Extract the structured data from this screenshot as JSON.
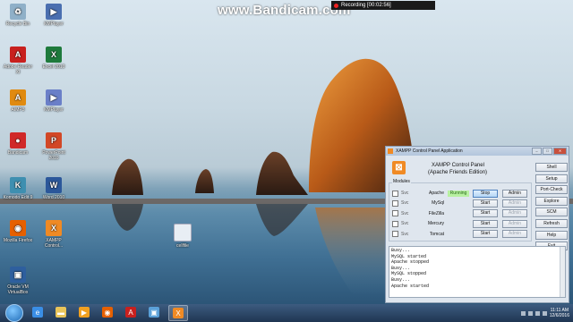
{
  "watermark": "www.Bandicam.com",
  "recording": {
    "label": "Recording [00:02:56]"
  },
  "desktop_icons": [
    {
      "label": "Recycle Bin",
      "icon": "recycle-bin-icon",
      "color": "#8fb0c8",
      "glyph": "♻"
    },
    {
      "label": "KMPlayer",
      "icon": "kmplayer-icon",
      "color": "#4a6fb0",
      "glyph": "▶"
    },
    {
      "label": "Adobe Reader XI",
      "icon": "adobe-reader-icon",
      "color": "#c8201e",
      "glyph": "A"
    },
    {
      "label": "Excel 2010",
      "icon": "excel-icon",
      "color": "#1e7a3c",
      "glyph": "X"
    },
    {
      "label": "AIMP3",
      "icon": "aimp-icon",
      "color": "#e08a10",
      "glyph": "A"
    },
    {
      "label": "KMPlayer",
      "icon": "kmplayer-icon",
      "color": "#6a7fc8",
      "glyph": "▶"
    },
    {
      "label": "Bandicam",
      "icon": "bandicam-icon",
      "color": "#d02828",
      "glyph": "●"
    },
    {
      "label": "PowerPoint 2010",
      "icon": "powerpoint-icon",
      "color": "#d24726",
      "glyph": "P"
    },
    {
      "label": "Komodo Edit 9",
      "icon": "komodo-icon",
      "color": "#3e8fb0",
      "glyph": "K"
    },
    {
      "label": "Word 2010",
      "icon": "word-icon",
      "color": "#2b579a",
      "glyph": "W"
    },
    {
      "label": "Mozilla Firefox",
      "icon": "firefox-icon",
      "color": "#e66000",
      "glyph": "◉"
    },
    {
      "label": "XAMPP Control...",
      "icon": "xampp-icon",
      "color": "#f08a24",
      "glyph": "X"
    },
    {
      "label": "Oracle VM VirtualBox",
      "icon": "virtualbox-icon",
      "color": "#2e5f9e",
      "glyph": "▣"
    },
    {
      "label": "cellfile",
      "icon": "file-icon",
      "color": "#e8eef4",
      "glyph": ""
    }
  ],
  "xampp": {
    "title": "XAMPP Control Panel Application",
    "header_line1": "XAMPP Control Panel",
    "header_line2": "(Apache Friends Edition)",
    "modules_label": "Modules",
    "svc_label": "Svc",
    "modules": [
      {
        "name": "Apache",
        "status": "Running",
        "action": "Stop",
        "admin": "Admin",
        "running": true
      },
      {
        "name": "MySql",
        "status": "",
        "action": "Start",
        "admin": "Admin",
        "running": false
      },
      {
        "name": "FileZilla",
        "status": "",
        "action": "Start",
        "admin": "Admin",
        "running": false
      },
      {
        "name": "Mercury",
        "status": "",
        "action": "Start",
        "admin": "Admin",
        "running": false
      },
      {
        "name": "Tomcat",
        "status": "",
        "action": "Start",
        "admin": "Admin",
        "running": false
      }
    ],
    "side_buttons": [
      "Shell",
      "Setup",
      "Port-Check",
      "Explore",
      "SCM",
      "Refresh",
      "Help",
      "Exit"
    ],
    "log": [
      "Busy...",
      "MySQL started",
      "Apache stopped",
      "Busy...",
      "MySQL stopped",
      "Busy...",
      "Apache started"
    ]
  },
  "taskbar": {
    "apps": [
      {
        "name": "internet-explorer-icon",
        "glyph": "e",
        "color": "#3a8ee6"
      },
      {
        "name": "folder-icon",
        "glyph": "▬",
        "color": "#e8c45a"
      },
      {
        "name": "media-player-icon",
        "glyph": "▶",
        "color": "#f0a020"
      },
      {
        "name": "firefox-icon",
        "glyph": "◉",
        "color": "#e66000"
      },
      {
        "name": "adobe-reader-icon",
        "glyph": "A",
        "color": "#c8201e"
      },
      {
        "name": "control-panel-icon",
        "glyph": "▣",
        "color": "#5aa0d8"
      },
      {
        "name": "xampp-icon",
        "glyph": "X",
        "color": "#f08a24"
      }
    ],
    "time": "11:11 AM",
    "date": "12/6/2016"
  }
}
